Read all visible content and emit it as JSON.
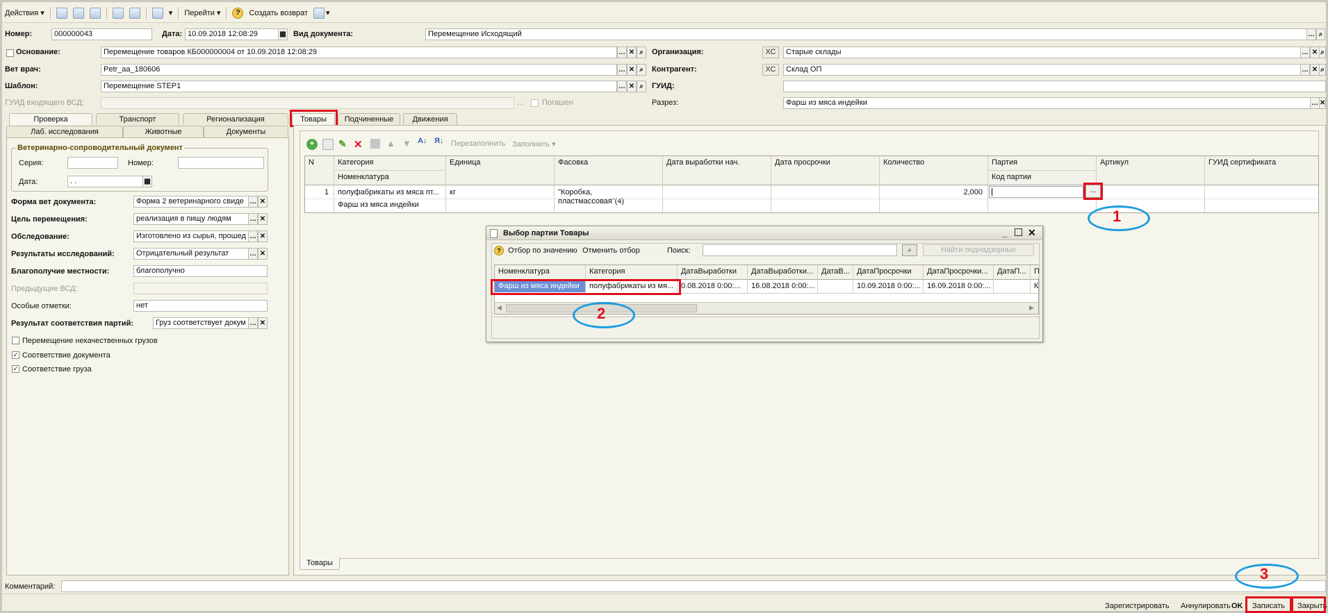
{
  "toolbar": {
    "actions": "Действия",
    "goto": "Перейти",
    "create_return": "Создать возврат"
  },
  "header": {
    "number_label": "Номер:",
    "number": "000000043",
    "date_label": "Дата:",
    "date": "10.09.2018 12:08:29",
    "doc_type_label": "Вид документа:",
    "doc_type": "Перемещение Исходящий",
    "basis_label": "Основание:",
    "basis": "Перемещение товаров КБ000000004 от 10.09.2018 12:08:29",
    "org_label": "Организация:",
    "org_prefix": "ХС",
    "org": "Старые склады",
    "vet_label": "Вет врач:",
    "vet": "Petr_aa_180606",
    "contractor_label": "Контрагент:",
    "contractor_prefix": "ХС",
    "contractor": "Склад ОП",
    "template_label": "Шаблон:",
    "template": "Перемещение STEP1",
    "guid_label": "ГУИД:",
    "guid": "",
    "incoming_guid_label": "ГУИД входящего ВСД:",
    "repaid_label": "Погашен",
    "section_label": "Разрез:",
    "section": "Фарш из мяса индейки"
  },
  "left_tabs": {
    "row1": [
      "Проверка",
      "Транспорт",
      "Регионализация"
    ],
    "row2": [
      "Лаб. исследования",
      "Животные",
      "Документы"
    ]
  },
  "vet_doc": {
    "group_title": "Ветеринарно-сопроводительный документ",
    "series_label": "Серия:",
    "number_label": "Номер:",
    "date_label": "Дата:",
    "date_value": " .  ."
  },
  "fields": {
    "form_label": "Форма вет документа:",
    "form_value": "Форма 2 ветеринарного свиде",
    "purpose_label": "Цель перемещения:",
    "purpose_value": "реализация в пищу людям",
    "exam_label": "Обследование:",
    "exam_value": "Изготовлено из сырья, прошед",
    "results_label": "Результаты исследований:",
    "results_value": "Отрицательный результат",
    "welfare_label": "Благополучие местности:",
    "welfare_value": "благополучно",
    "prev_label": "Предыдущие ВСД:",
    "notes_label": "Особые отметки:",
    "notes_value": "нет",
    "match_label": "Результат соответствия партий:",
    "match_value": "Груз соответствует докум",
    "chk1": "Перемещение некачественных грузов",
    "chk2": "Соответствие документа",
    "chk3": "Соответствие груза"
  },
  "right_tabs": [
    "Товары",
    "Подчиненные",
    "Движения"
  ],
  "goods_toolbar": {
    "refill": "Перезаполнить",
    "fill": "Заполнить"
  },
  "goods_grid": {
    "headers": [
      "N",
      "Категория",
      "Единица",
      "Фасовка",
      "Дата выработки нач.",
      "Дата просрочки",
      "Количество",
      "Партия",
      "Артикул",
      "ГУИД сертификата"
    ],
    "subheaders": {
      "category": "Номенклатура",
      "batch": "Код партии"
    },
    "row": {
      "n": "1",
      "category": "полуфабрикаты из мяса пт...",
      "nomenclature": "Фарш из мяса индейки",
      "unit": "кг",
      "packing": "\"Коробка, пластмассовая\"(4)",
      "quantity": "2,000",
      "select_btn": "..."
    }
  },
  "bottom_tab": "Товары",
  "dialog": {
    "title": "Выбор партии Товары",
    "filter_by_value": "Отбор по значению",
    "cancel_filter": "Отменить отбор",
    "search_label": "Поиск:",
    "find_supervised": "Найти поднадзорных",
    "headers": [
      "Номенклатура",
      "Категория",
      "ДатаВыработки",
      "ДатаВыработки...",
      "ДатаВ...",
      "ДатаПросрочки",
      "ДатаПросрочки...",
      "ДатаП...",
      "П"
    ],
    "row": [
      "Фарш из мяса индейки",
      "полуфабрикаты из мя...",
      "0.08.2018 0:00:...",
      "16.08.2018 0:00:...",
      "",
      "10.09.2018 0:00:...",
      "16.09.2018 0:00:...",
      "",
      "К"
    ]
  },
  "comment_label": "Комментарий:",
  "footer": {
    "register": "Зарегистрировать",
    "cancel": "Аннулировать",
    "ok": "OK",
    "save": "Записать",
    "close": "Закрыть"
  },
  "annotations": {
    "one": "1",
    "two": "2",
    "three": "3"
  },
  "colors": {
    "highlight_red": "#e0101e",
    "annotation_blue": "#1c9de0",
    "selected_row": "#6b8fd6"
  }
}
